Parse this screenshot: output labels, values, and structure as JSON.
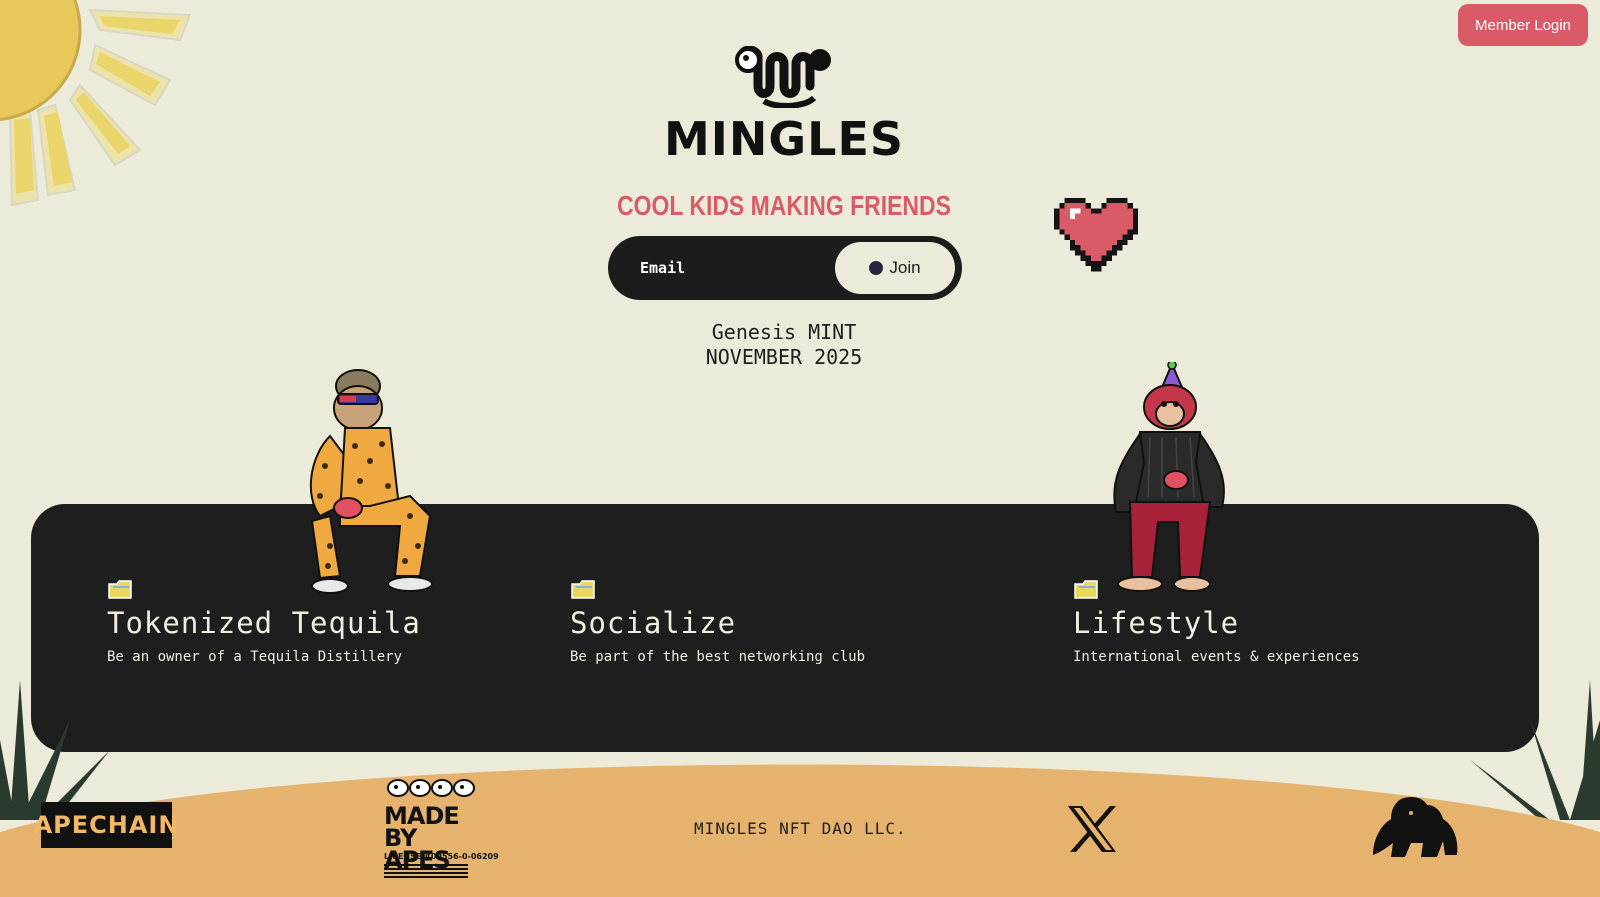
{
  "header": {
    "member_login_label": "Member Login",
    "brand_name": "MINGLES",
    "tagline": "COOL KIDS MAKING FRIENDS"
  },
  "signup": {
    "email_placeholder": "Email",
    "join_label": "Join"
  },
  "mint": {
    "line1": "Genesis MINT",
    "line2": "NOVEMBER 2025"
  },
  "features": [
    {
      "title": "Tokenized Tequila",
      "description": "Be an owner of a Tequila Distillery",
      "icon": "folder-icon"
    },
    {
      "title": "Socialize",
      "description": "Be part of the best networking club",
      "icon": "folder-icon"
    },
    {
      "title": "Lifestyle",
      "description": "International events & experiences",
      "icon": "folder-icon"
    }
  ],
  "footer": {
    "apechain_label": "APECHAIN",
    "made_by_apes_line1": "MADE",
    "made_by_apes_line2": "BY APES",
    "license_text": "LICENSE #00556-0-06209",
    "org_name": "MINGLES NFT DAO LLC.",
    "x_icon": "x-logo-icon",
    "gorilla_icon": "gorilla-logo-icon"
  },
  "colors": {
    "background": "#ECEBDA",
    "accent": "#D95B67",
    "panel": "#1E1E1E",
    "ground": "#E6B36E"
  }
}
